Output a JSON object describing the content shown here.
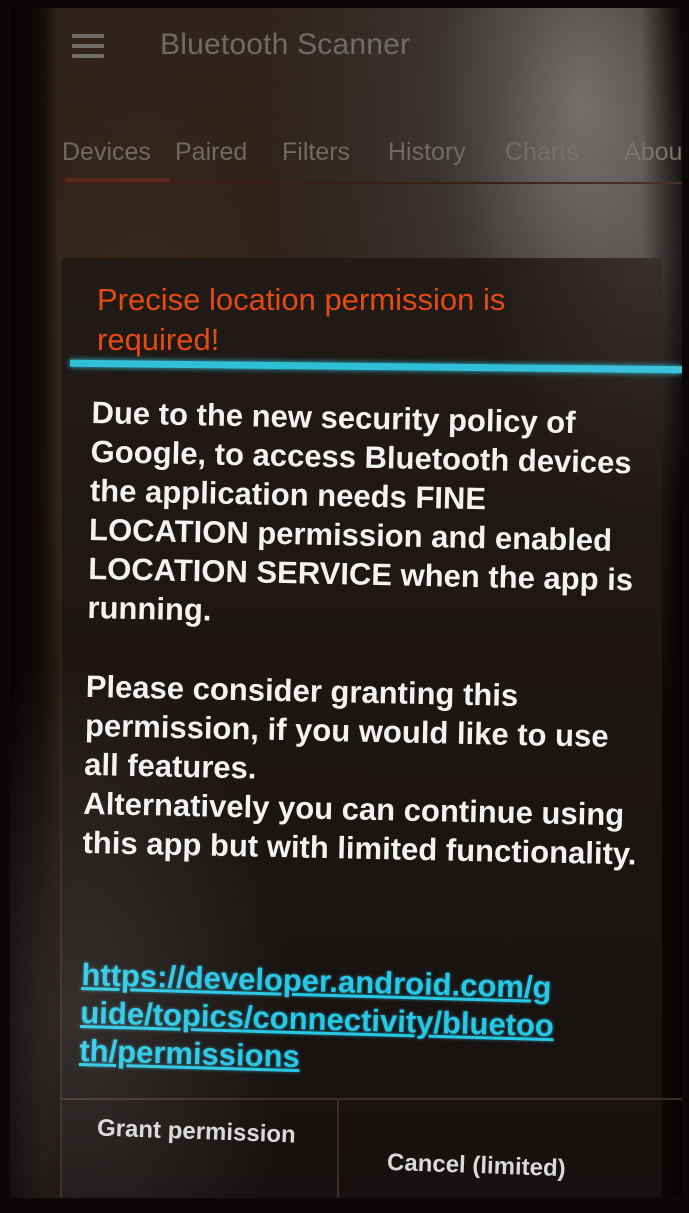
{
  "app_bar": {
    "menu_icon": "menu-icon",
    "title": "Bluetooth Scanner"
  },
  "tabs": [
    {
      "label": "Devices"
    },
    {
      "label": "Paired"
    },
    {
      "label": "Filters"
    },
    {
      "label": "History"
    },
    {
      "label": "Charts"
    },
    {
      "label": "Abou"
    }
  ],
  "dialog": {
    "title": "Precise location permission is required!",
    "body_paragraph_1": "Due to the new security policy of Google, to access Bluetooth devices the application needs FINE LOCATION permission and enabled LOCATION SERVICE when the app is running.",
    "body_paragraph_2": "Please consider granting this permission, if you would like to use all features.",
    "body_paragraph_3": "Alternatively you can continue using this app but with limited functionality.",
    "link": "https://developer.android.com/guide/topics/connectivity/bluetooth/permissions",
    "grant_button": "Grant permission",
    "cancel_button": "Cancel (limited)"
  },
  "colors": {
    "title_accent": "#e24a16",
    "divider": "#2fc0d8",
    "link": "#27c7e6"
  }
}
